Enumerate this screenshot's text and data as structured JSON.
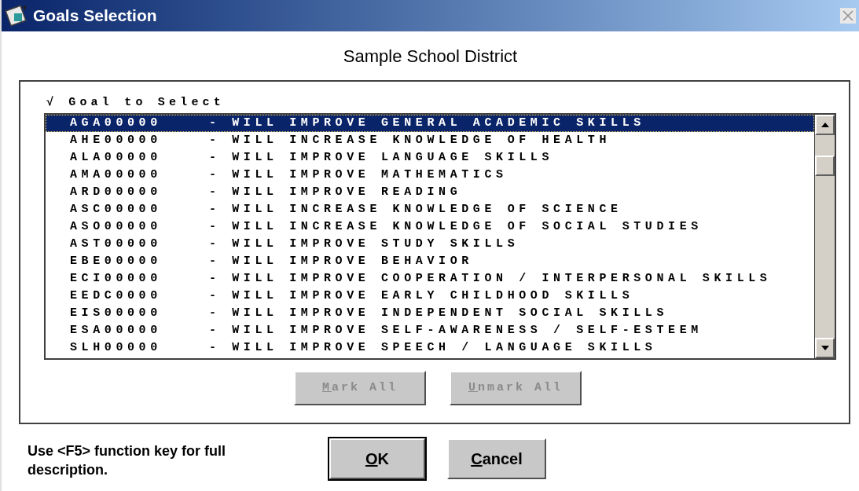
{
  "window": {
    "title": "Goals Selection"
  },
  "heading": "Sample School District",
  "list": {
    "header_mark": "√",
    "header": "Goal to Select",
    "rows": [
      {
        "code": "AGA00000",
        "description": "- WILL IMPROVE GENERAL ACADEMIC SKILLS",
        "selected": true
      },
      {
        "code": "AHE00000",
        "description": "- WILL INCREASE KNOWLEDGE OF HEALTH",
        "selected": false
      },
      {
        "code": "ALA00000",
        "description": "- WILL IMPROVE LANGUAGE SKILLS",
        "selected": false
      },
      {
        "code": "AMA00000",
        "description": "- WILL IMPROVE MATHEMATICS",
        "selected": false
      },
      {
        "code": "ARD00000",
        "description": "- WILL IMPROVE READING",
        "selected": false
      },
      {
        "code": "ASC00000",
        "description": "- WILL INCREASE KNOWLEDGE OF SCIENCE",
        "selected": false
      },
      {
        "code": "ASO00000",
        "description": "- WILL INCREASE KNOWLEDGE OF SOCIAL STUDIES",
        "selected": false
      },
      {
        "code": "AST00000",
        "description": "- WILL IMPROVE STUDY SKILLS",
        "selected": false
      },
      {
        "code": "EBE00000",
        "description": "- WILL IMPROVE BEHAVIOR",
        "selected": false
      },
      {
        "code": "ECI00000",
        "description": "- WILL IMPROVE COOPERATION / INTERPERSONAL SKILLS",
        "selected": false
      },
      {
        "code": "EEDC0000",
        "description": "- WILL IMPROVE EARLY CHILDHOOD SKILLS",
        "selected": false
      },
      {
        "code": "EIS00000",
        "description": "- WILL IMPROVE INDEPENDENT SOCIAL SKILLS",
        "selected": false
      },
      {
        "code": "ESA00000",
        "description": "- WILL IMPROVE SELF-AWARENESS / SELF-ESTEEM",
        "selected": false
      },
      {
        "code": "SLH00000",
        "description": "- WILL IMPROVE SPEECH / LANGUAGE SKILLS",
        "selected": false
      }
    ],
    "buttons": [
      {
        "underlined": "M",
        "rest": "ark All",
        "disabled": true
      },
      {
        "underlined": "U",
        "rest": "nmark All",
        "disabled": true
      }
    ]
  },
  "hint": "Use <F5> function key for full description.",
  "buttons": [
    {
      "underlined": "O",
      "rest": "K",
      "default": true
    },
    {
      "underlined": "C",
      "rest": "ancel",
      "default": false
    }
  ]
}
